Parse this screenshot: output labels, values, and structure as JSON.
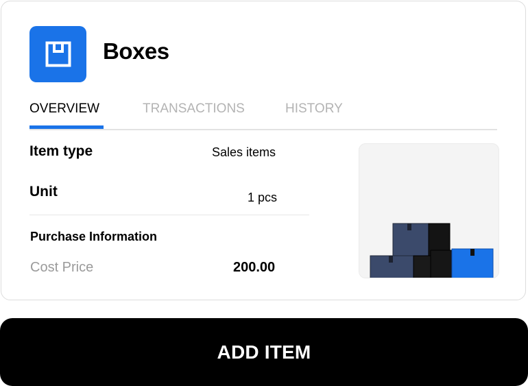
{
  "item": {
    "title": "Boxes",
    "icon": "box-icon"
  },
  "tabs": [
    {
      "label": "OVERVIEW",
      "active": true
    },
    {
      "label": "TRANSACTIONS",
      "active": false
    },
    {
      "label": "HISTORY",
      "active": false
    }
  ],
  "details": {
    "item_type_label": "Item type",
    "item_type_value": "Sales items",
    "unit_label": "Unit",
    "unit_value": "1 pcs"
  },
  "purchase": {
    "section_title": "Purchase Information",
    "cost_price_label": "Cost Price",
    "cost_price_value": "200.00"
  },
  "actions": {
    "add_item_label": "ADD ITEM"
  },
  "colors": {
    "accent": "#1a73e8",
    "button_bg": "#000000",
    "muted_text": "#9a9a9a"
  }
}
